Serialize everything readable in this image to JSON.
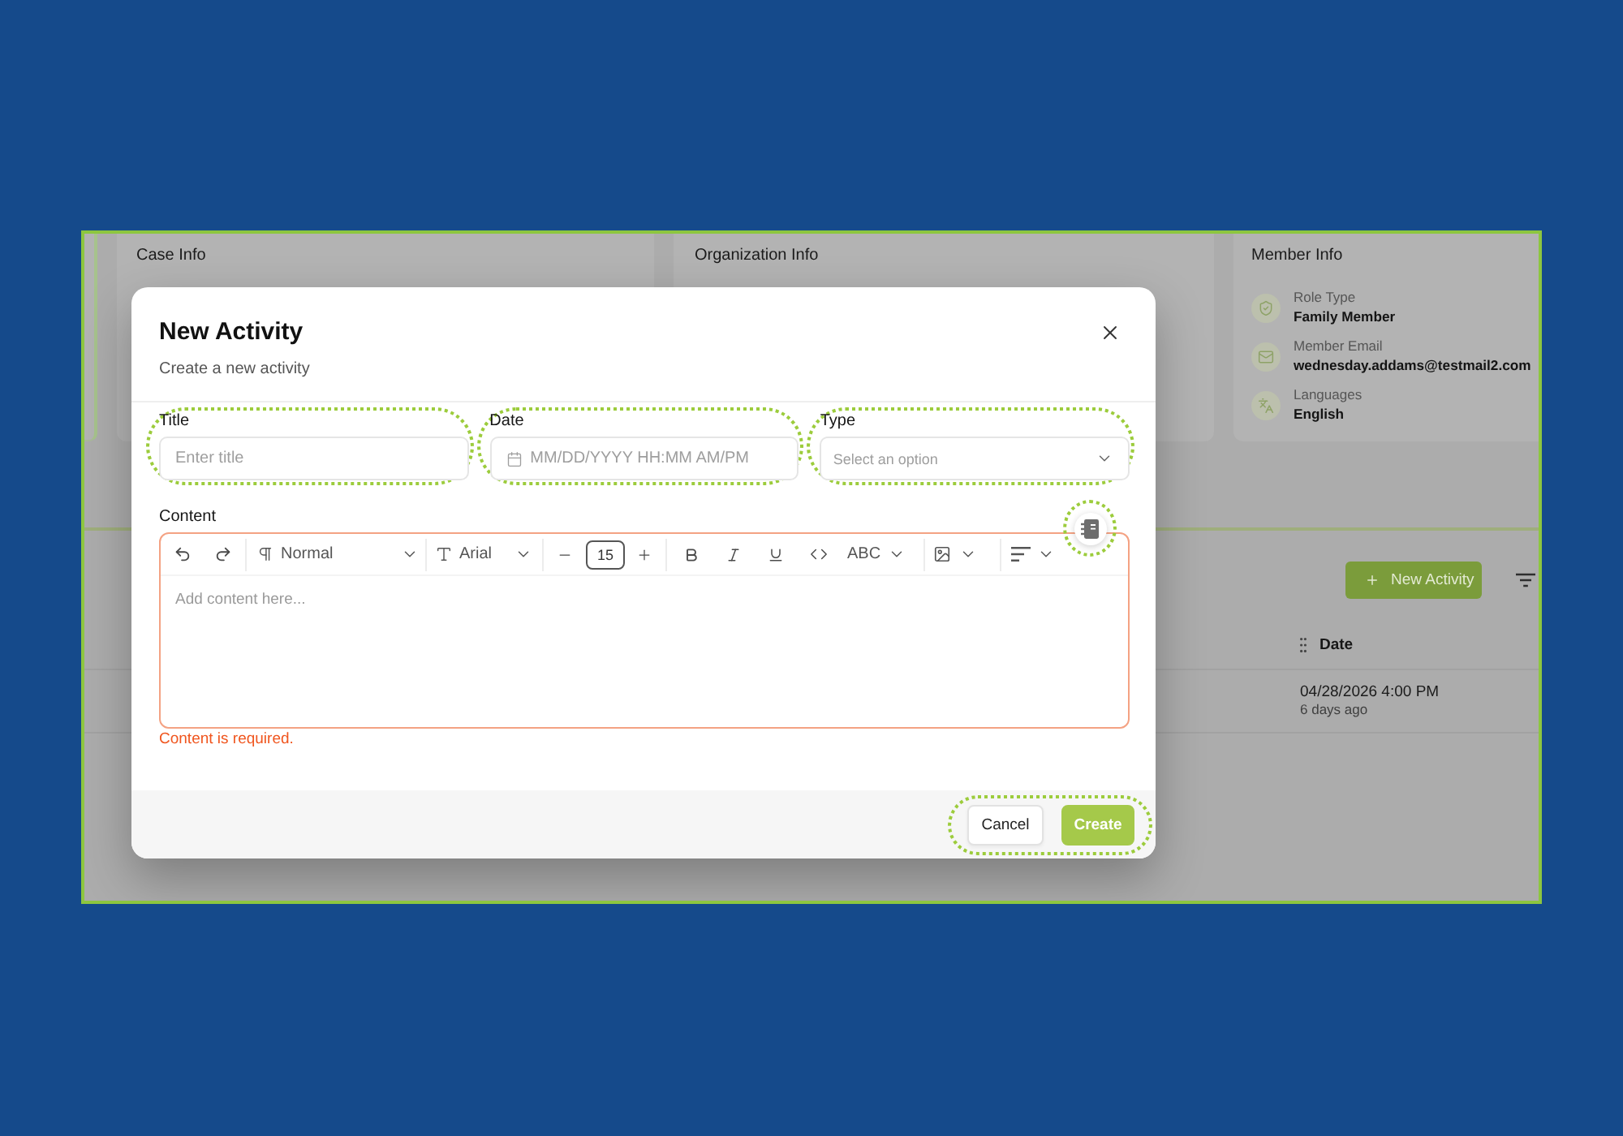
{
  "page": {
    "cards": [
      {
        "title": "Case Info"
      },
      {
        "title": "Organization Info"
      },
      {
        "title": "Member Info",
        "details": [
          {
            "kind": "role",
            "label": "Role Type",
            "value": "Family Member"
          },
          {
            "kind": "email",
            "label": "Member Email",
            "value": "wednesday.addams@testmail2.com"
          },
          {
            "kind": "language",
            "label": "Languages",
            "value": "English"
          }
        ]
      }
    ],
    "new_activity_button": {
      "label": "New Activity"
    },
    "table": {
      "columns": [
        "Date"
      ],
      "rows": [
        {
          "date": "04/28/2026 4:00 PM",
          "relative_time": "6 days ago"
        }
      ]
    }
  },
  "dialog": {
    "title": "New Activity",
    "subtitle": "Create a new activity",
    "fields": [
      {
        "kind": "text",
        "label": "Title",
        "placeholder": "Enter title",
        "highlighted": true
      },
      {
        "kind": "datetime",
        "label": "Date",
        "placeholder": "MM/DD/YYYY HH:MM AM/PM",
        "highlighted": true
      },
      {
        "kind": "select",
        "label": "Type",
        "placeholder": "Select an option",
        "highlighted": true
      }
    ],
    "content": {
      "label": "Content",
      "template_button": {
        "highlighted": true
      },
      "toolbar": {
        "block_style": "Normal",
        "font_family": "Arial",
        "font_size": "15",
        "abc_dropdown": "ABC"
      },
      "placeholder": "Add content here...",
      "invalid": true,
      "error": "Content is required."
    },
    "footer": {
      "highlighted": true,
      "buttons": [
        {
          "kind": "secondary",
          "label": "Cancel"
        },
        {
          "kind": "primary",
          "label": "Create"
        }
      ]
    }
  }
}
